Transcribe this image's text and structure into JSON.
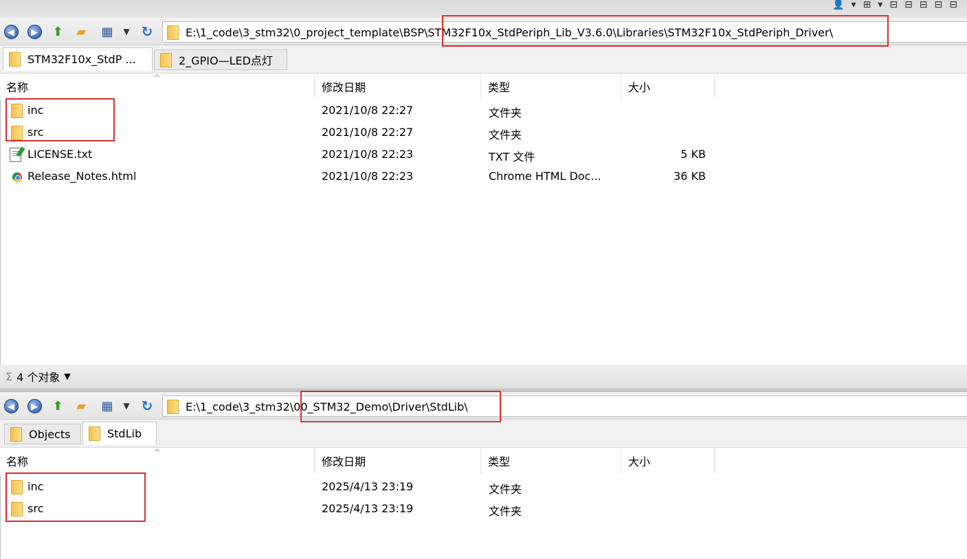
{
  "top_icons": [
    "person-icon",
    "dropdown-icon",
    "layout-icon",
    "dropdown-icon",
    "pane-icon-1",
    "pane-icon-2",
    "pane-icon-3",
    "pane-icon-4",
    "pane-icon-5"
  ],
  "pane1": {
    "address": "E:\\1_code\\3_stm32\\0_project_template\\BSP\\STM32F10x_StdPeriph_Lib_V3.6.0\\Libraries\\STM32F10x_StdPeriph_Driver\\",
    "tabs": [
      {
        "label": "STM32F10x_StdP ...",
        "active": true
      },
      {
        "label": "2_GPIO—LED点灯",
        "active": false
      }
    ],
    "columns": {
      "name": "名称",
      "date": "修改日期",
      "type": "类型",
      "size": "大小"
    },
    "rows": [
      {
        "name": "inc",
        "date": "2021/10/8 22:27",
        "type": "文件夹",
        "size": "",
        "icon": "folder-icon"
      },
      {
        "name": "src",
        "date": "2021/10/8 22:27",
        "type": "文件夹",
        "size": "",
        "icon": "folder-icon"
      },
      {
        "name": "LICENSE.txt",
        "date": "2021/10/8 22:23",
        "type": "TXT 文件",
        "size": "5 KB",
        "icon": "text-file-icon"
      },
      {
        "name": "Release_Notes.html",
        "date": "2021/10/8 22:23",
        "type": "Chrome HTML Doc...",
        "size": "36 KB",
        "icon": "chrome-icon"
      }
    ]
  },
  "status": {
    "text": "4 个对象"
  },
  "pane2": {
    "address": "E:\\1_code\\3_stm32\\00_STM32_Demo\\Driver\\StdLib\\",
    "tabs": [
      {
        "label": "Objects",
        "active": false
      },
      {
        "label": "StdLib",
        "active": true
      }
    ],
    "columns": {
      "name": "名称",
      "date": "修改日期",
      "type": "类型",
      "size": "大小"
    },
    "rows": [
      {
        "name": "inc",
        "date": "2025/4/13 23:19",
        "type": "文件夹",
        "size": "",
        "icon": "folder-icon"
      },
      {
        "name": "src",
        "date": "2025/4/13 23:19",
        "type": "文件夹",
        "size": "",
        "icon": "folder-icon"
      }
    ]
  },
  "colors": {
    "highlight_box": "#d82e2e",
    "folder": "#f2c14e"
  }
}
